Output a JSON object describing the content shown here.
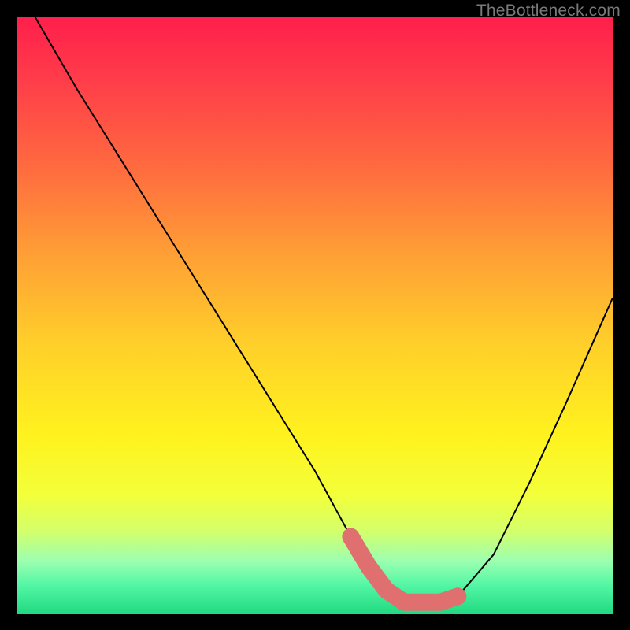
{
  "watermark": "TheBottleneck.com",
  "chart_data": {
    "type": "line",
    "title": "",
    "xlabel": "",
    "ylabel": "",
    "xlim": [
      0,
      100
    ],
    "ylim": [
      0,
      100
    ],
    "series": [
      {
        "name": "curve",
        "x": [
          3,
          10,
          20,
          30,
          40,
          50,
          56,
          59,
          62,
          65,
          68,
          71,
          74,
          80,
          86,
          92,
          100
        ],
        "values": [
          100,
          88,
          72,
          56,
          40,
          24,
          13,
          8,
          4,
          2,
          2,
          2,
          3,
          10,
          22,
          35,
          53
        ]
      },
      {
        "name": "highlight-band",
        "x": [
          56,
          59,
          62,
          65,
          68,
          71,
          74
        ],
        "values": [
          13,
          8,
          4,
          2,
          2,
          2,
          3
        ]
      }
    ],
    "gradient_stops": [
      {
        "offset": 0.0,
        "color": "#ff1f4b"
      },
      {
        "offset": 0.1,
        "color": "#ff3b4a"
      },
      {
        "offset": 0.25,
        "color": "#ff6a3f"
      },
      {
        "offset": 0.4,
        "color": "#ffa035"
      },
      {
        "offset": 0.55,
        "color": "#ffd02a"
      },
      {
        "offset": 0.7,
        "color": "#fff21e"
      },
      {
        "offset": 0.8,
        "color": "#f3ff3a"
      },
      {
        "offset": 0.86,
        "color": "#d4ff6a"
      },
      {
        "offset": 0.91,
        "color": "#9dffb0"
      },
      {
        "offset": 0.95,
        "color": "#55f7a6"
      },
      {
        "offset": 1.0,
        "color": "#1fd981"
      }
    ],
    "highlight_color": "#e07070",
    "curve_color": "#000000"
  }
}
